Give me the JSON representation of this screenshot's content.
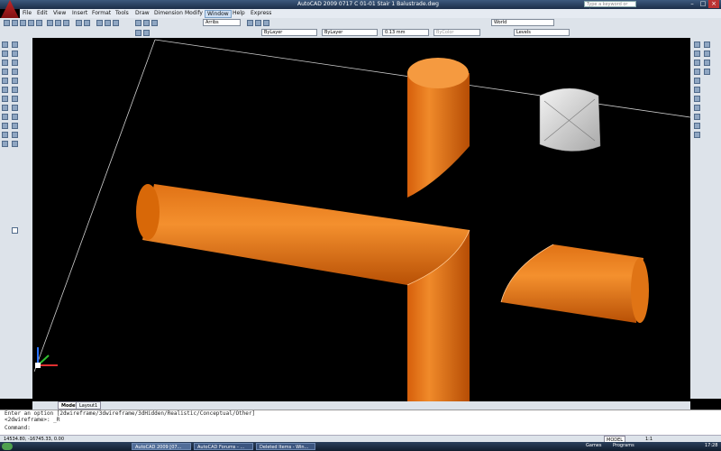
{
  "window": {
    "title": "AutoCAD 2009 0717 C 01-01 Stair 1 Balustrade.dwg",
    "help_search_placeholder": "Type a keyword or phrase"
  },
  "menu": [
    "File",
    "Edit",
    "View",
    "Insert",
    "Format",
    "Tools",
    "Draw",
    "Dimension",
    "Modify",
    "Window",
    "Help",
    "Express"
  ],
  "active_menu": "Window",
  "toolbar": {
    "text_style": "Arribs",
    "layer": "ByLayer",
    "linetype": "ByLayer",
    "lineweight": "0.13 mm",
    "plotstyle": "ByColor",
    "layer_state": "Levels",
    "ucs": "World"
  },
  "tabs": [
    "Model",
    "Layout1"
  ],
  "active_tab": "Model",
  "command": {
    "line1": "Enter an option [2dwireframe/3dwireframe/3dHidden/Realistic/Conceptual/Other]",
    "line2": "<2dwireframe>: _R",
    "prompt": "Command:"
  },
  "status": {
    "coordinates": "14534.80, -16745.33, 0.00",
    "space": "MODEL",
    "scale": "1:1"
  },
  "taskbar": {
    "items": [
      "AutoCAD 2009 [07...",
      "AutoCAD Forums - ...",
      "Deleted Items - Win..."
    ],
    "right_items": [
      "Games",
      "Programs"
    ],
    "clock": "17:28"
  },
  "colors": {
    "accent": "#e8761a",
    "viewport": "#000000",
    "box": "#d8d8d8"
  },
  "icons": [
    "app-logo-icon",
    "minimize-icon",
    "maximize-icon",
    "close-icon",
    "ucs-icon",
    "start-icon"
  ]
}
